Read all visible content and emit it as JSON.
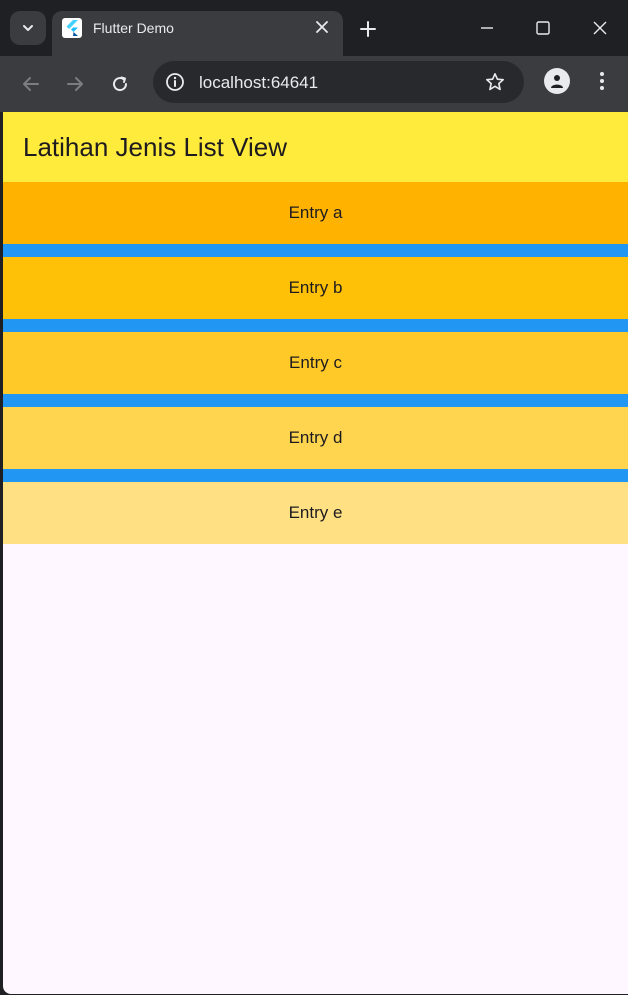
{
  "browser": {
    "tab_title": "Flutter Demo",
    "url": "localhost:64641"
  },
  "app": {
    "title": "Latihan Jenis List View",
    "entries": [
      {
        "label": "Entry a",
        "color": "#ffb300"
      },
      {
        "label": "Entry b",
        "color": "#ffc107"
      },
      {
        "label": "Entry c",
        "color": "#ffca28"
      },
      {
        "label": "Entry d",
        "color": "#ffd54f"
      },
      {
        "label": "Entry e",
        "color": "#ffe082"
      }
    ],
    "appbar_color": "#ffeb3b",
    "divider_color": "#2196f3",
    "background_color": "#fef7ff"
  }
}
